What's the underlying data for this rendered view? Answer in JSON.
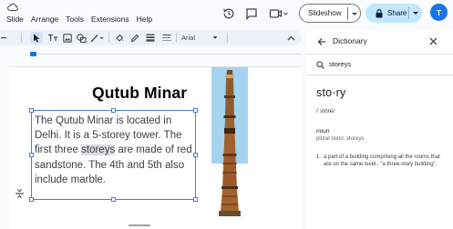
{
  "menu": [
    "Slide",
    "Arrange",
    "Tools",
    "Extensions",
    "Help"
  ],
  "top_actions": {
    "slideshow_label": "Slideshow",
    "share_label": "Share",
    "avatar_initial": "T"
  },
  "toolbar": {
    "font_name": "Arial"
  },
  "slide": {
    "title": "Qutub Minar",
    "body_before": "The Qutub Minar is located in Delhi. It is a 5-storey tower. The first three ",
    "body_highlight": "storeys",
    "body_after": " are made of red sandstone. The 4th and 5th also include marble."
  },
  "dictionary": {
    "panel_title": "Dictionary",
    "search_query": "storeys",
    "headword": "sto·ry",
    "pronunciation": "/ˈstôrē/",
    "part_of_speech": "noun",
    "plural": "plural noun: storeys",
    "definitions": [
      {
        "number": "1.",
        "text": "a part of a building comprising all the rooms that are on the same level.: \"a three-story building\"."
      }
    ]
  },
  "colors": {
    "accent": "#1a73e8",
    "share_bg": "#c2e7ff",
    "toolbar_bg": "#edf2fa",
    "sky": "#a4d4f0",
    "tower_brick": "#9c5a2c"
  }
}
